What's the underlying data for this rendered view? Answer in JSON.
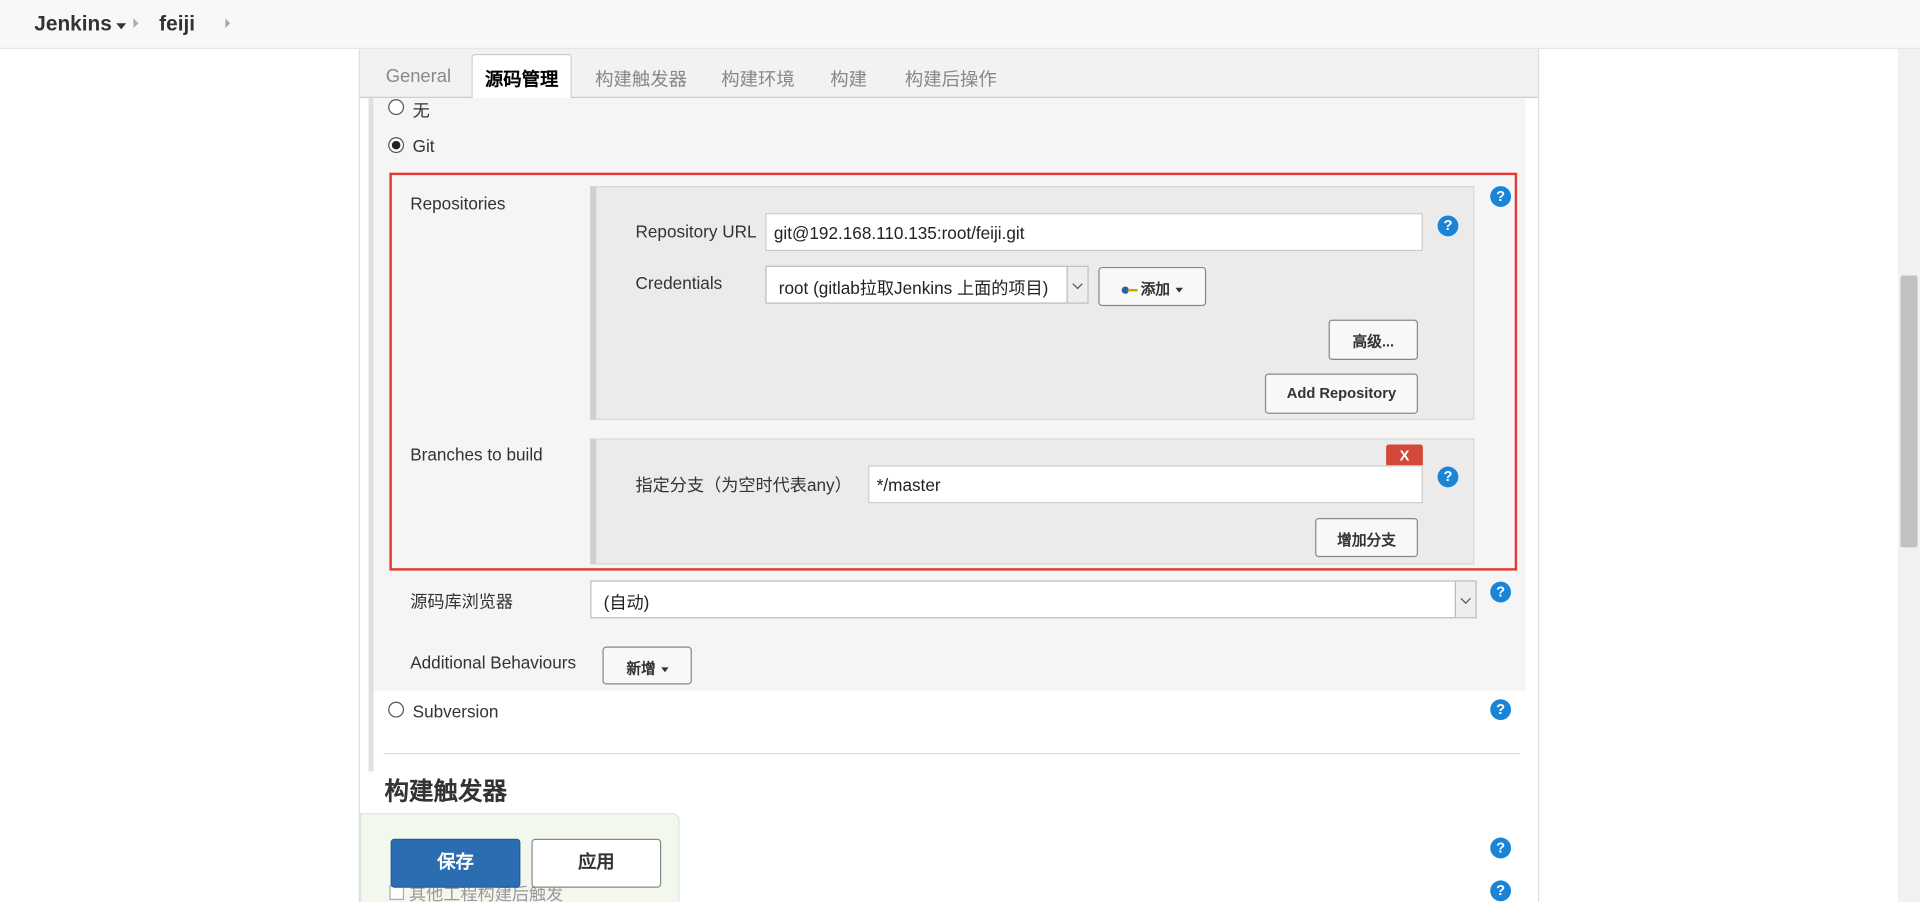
{
  "breadcrumb": {
    "root": "Jenkins",
    "project": "feiji"
  },
  "tabs": [
    "General",
    "源码管理",
    "构建触发器",
    "构建环境",
    "构建",
    "构建后操作"
  ],
  "scm": {
    "option_none": "无",
    "option_git": "Git",
    "option_svn": "Subversion",
    "repositories_label": "Repositories",
    "repo_url_label": "Repository URL",
    "repo_url_value": "git@192.168.110.135:root/feiji.git",
    "credentials_label": "Credentials",
    "credentials_value": "root (gitlab拉取Jenkins 上面的项目)",
    "add_button": "添加",
    "advanced_button": "高级...",
    "add_repository_button": "Add Repository",
    "branches_label": "Branches to build",
    "branch_spec_label": "指定分支（为空时代表any）",
    "branch_spec_value": "*/master",
    "delete_button": "X",
    "add_branch_button": "增加分支",
    "browser_label": "源码库浏览器",
    "browser_value": "(自动)",
    "behaviours_label": "Additional Behaviours",
    "behaviours_button": "新增"
  },
  "triggers_heading": "构建触发器",
  "footer": {
    "save": "保存",
    "apply": "应用",
    "partial_text": "其他工程构建后触发"
  },
  "help_glyph": "?",
  "colors": {
    "accent": "#1a84d6",
    "highlight_border": "#e53935",
    "save_button": "#2a6db0",
    "delete_button": "#d24939"
  }
}
